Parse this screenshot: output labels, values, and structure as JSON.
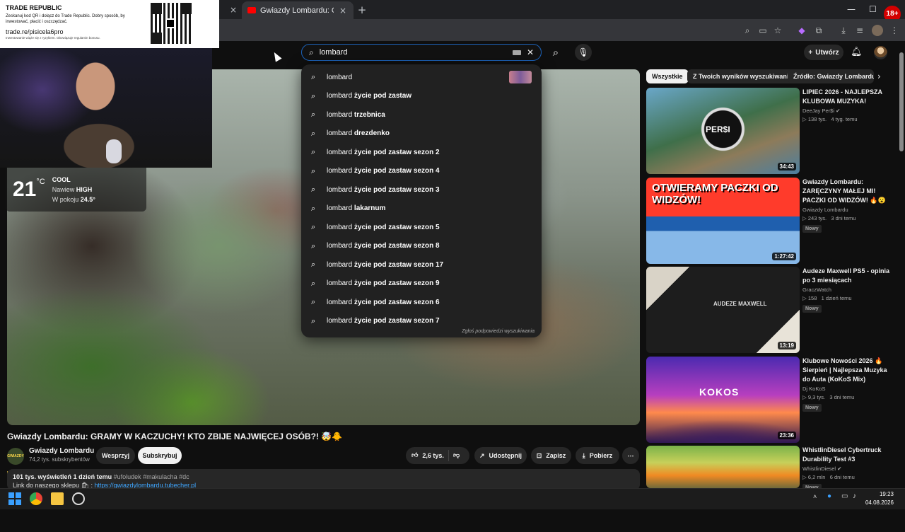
{
  "browser": {
    "active_tab_title": "Gwiazdy Lombardu: GRAMY",
    "tab_close": "×",
    "new_tab": "+",
    "window": {
      "minimize": "—",
      "maximize": "☐",
      "close": "✕"
    },
    "age_badge": "18+"
  },
  "ad": {
    "title": "TRADE REPUBLIC",
    "body": "Zeskanuj kod QR i dołącz do Trade Republic. Dobry sposób, by inwestować, płacić i oszczędzać.",
    "link": "trade.re/pisicela6pro",
    "note": "Inwestowanie wiąże się z ryzykiem. Obowiązuje regulamin bonusu."
  },
  "weather": {
    "temp": "21",
    "unit": "°C",
    "line1": "COOL",
    "line2_label": "Nawiew",
    "line2_value": "HIGH",
    "line3_label": "W pokoju",
    "line3_value": "24.5°"
  },
  "header": {
    "search_value": "lombard",
    "create_label": "Utwórz"
  },
  "suggestions": {
    "items": [
      {
        "pre": "lombard",
        "suf": ""
      },
      {
        "pre": "lombard",
        "suf": " życie pod zastaw"
      },
      {
        "pre": "lombard",
        "suf": " trzebnica"
      },
      {
        "pre": "lombard",
        "suf": " drezdenko"
      },
      {
        "pre": "lombard",
        "suf": " życie pod zastaw sezon 2"
      },
      {
        "pre": "lombard",
        "suf": " życie pod zastaw sezon 4"
      },
      {
        "pre": "lombard",
        "suf": " życie pod zastaw sezon 3"
      },
      {
        "pre": "lombard",
        "suf": " lakarnum"
      },
      {
        "pre": "lombard",
        "suf": " życie pod zastaw sezon 5"
      },
      {
        "pre": "lombard",
        "suf": " życie pod zastaw sezon 8"
      },
      {
        "pre": "lombard",
        "suf": " życie pod zastaw sezon 17"
      },
      {
        "pre": "lombard",
        "suf": " życie pod zastaw sezon 9"
      },
      {
        "pre": "lombard",
        "suf": " życie pod zastaw sezon 6"
      },
      {
        "pre": "lombard",
        "suf": " życie pod zastaw sezon 7"
      }
    ],
    "report": "Zgłoś podpowiedzi wyszukiwania"
  },
  "video": {
    "title": "Gwiazdy Lombardu: GRAMY W KACZUCHY! KTO ZBIJE NAJWIĘCEJ OSÓB?! 🤯🐥",
    "channel": "Gwiazdy Lombardu",
    "channel_avatar_text": "GWIAZDY LOMBARDU",
    "subs": "74,2 tys. subskrybentów",
    "support": "Wesprzyj",
    "subscribe": "Subskrybuj",
    "likes": "2,6 tys.",
    "share": "Udostępnij",
    "save": "Zapisz",
    "download": "Pobierz",
    "views": "101 tys. wyświetleń",
    "age": "1 dzień temu",
    "tags": "#ufoludek #makulacha #dc",
    "desc_line2": "Link do naszego sklepu 🛍 :",
    "desc_link": "https://gwiazdylombardu.tubecher.pl"
  },
  "chips": [
    "Wszystkie",
    "Z Twoich wyników wyszukiwania",
    "Źródło: Gwiazdy Lombardu"
  ],
  "sidebar": [
    {
      "title": "LIPIEC 2026 - NAJLEPSZA KLUBOWA MUZYKA!",
      "channel": "DeeJay Per$i ✔",
      "views": "138 tys.",
      "age": "4 tyg. temu",
      "duration": "34:43",
      "badge": ""
    },
    {
      "title": "Gwiazdy Lombardu: ZARĘCZYNY MAŁEJ MI! PACZKI OD WIDZÓW! 🔥😮",
      "channel": "Gwiazdy Lombardu",
      "views": "243 tys.",
      "age": "3 dni temu",
      "duration": "1:27:42",
      "badge": "Nowy"
    },
    {
      "title": "Audeze Maxwell PS5 - opinia po 3 miesiącach",
      "channel": "GraczWatch",
      "views": "158",
      "age": "1 dzień temu",
      "duration": "13:19",
      "badge": "Nowy"
    },
    {
      "title": "Klubowe Nowości 2026 🔥 Sierpień | Najlepsza Muzyka do Auta (KoKoS Mix)",
      "channel": "Dj KoKoS",
      "views": "9,3 tys.",
      "age": "3 dni temu",
      "duration": "23:36",
      "badge": "Nowy"
    },
    {
      "title": "WhistlinDiesel Cybertruck Durability Test #3",
      "channel": "WhistlinDiesel ✔",
      "views": "6,2 mln",
      "age": "6 dni temu",
      "duration": "",
      "badge": "Nowy"
    }
  ],
  "thumb_text": {
    "t0": "PER$I",
    "t1": "OTWIERAMY PACZKI OD WIDZÓW!",
    "t2": "AUDEZE MAXWELL",
    "t3": "KOKOS"
  },
  "taskbar": {
    "time": "19:23",
    "date": "04.08.2026"
  },
  "colors": {
    "accent_blue": "#1c62b9",
    "yt_red": "#ff0000",
    "bg": "#0f0f0f"
  }
}
